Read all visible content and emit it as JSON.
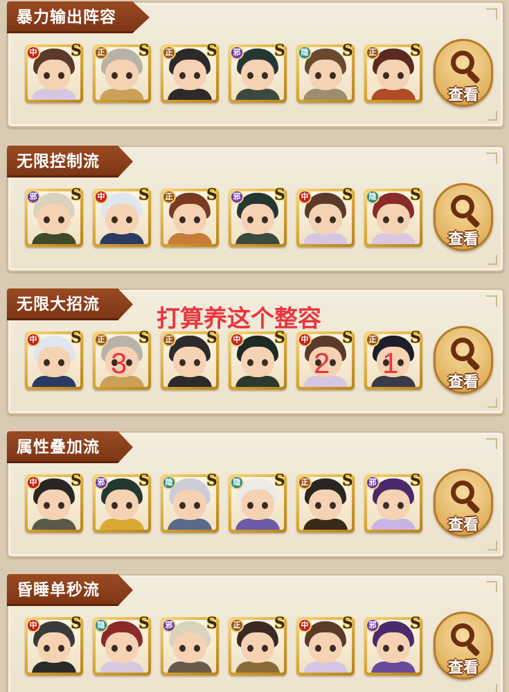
{
  "colors": {
    "zhong": "#c0231b",
    "zheng": "#9a5a1a",
    "xie": "#6a3aa8",
    "yin": "#2b8a86",
    "annotation": "#e8363e"
  },
  "view_label": "查看",
  "lineups": [
    {
      "title": "暴力输出阵容",
      "heroes": [
        {
          "faction": "中",
          "hair": "#5b3a2a",
          "body": "#d6c6e4"
        },
        {
          "faction": "正",
          "hair": "#b9b2a6",
          "body": "#c9a15a"
        },
        {
          "faction": "正",
          "hair": "#2d2b2a",
          "body": "#2c2a2a"
        },
        {
          "faction": "邪",
          "hair": "#243832",
          "body": "#3a4a3e"
        },
        {
          "faction": "隐",
          "hair": "#6a4a2e",
          "body": "#9c8e6e"
        },
        {
          "faction": "正",
          "hair": "#5a2a20",
          "body": "#b04a28"
        }
      ]
    },
    {
      "title": "无限控制流",
      "heroes": [
        {
          "faction": "邪",
          "hair": "#d9d2bd",
          "body": "#3e4a2a"
        },
        {
          "faction": "中",
          "hair": "#dfe6ef",
          "body": "#2b3a63"
        },
        {
          "faction": "正",
          "hair": "#7a3a20",
          "body": "#c97c3a"
        },
        {
          "faction": "邪",
          "hair": "#243832",
          "body": "#3a4a3e"
        },
        {
          "faction": "中",
          "hair": "#5b3a2a",
          "body": "#d6c6e4"
        },
        {
          "faction": "隐",
          "hair": "#8a2a2a",
          "body": "#d9c8e0"
        }
      ]
    },
    {
      "title": "无限大招流",
      "heroes": [
        {
          "faction": "中",
          "hair": "#dfe6ef",
          "body": "#2b3a63"
        },
        {
          "faction": "正",
          "hair": "#b9b2a6",
          "body": "#c9a15a"
        },
        {
          "faction": "正",
          "hair": "#2d2b2a",
          "body": "#2c2a2a"
        },
        {
          "faction": "中",
          "hair": "#1e2a24",
          "body": "#2a3a2c"
        },
        {
          "faction": "中",
          "hair": "#5b3a2a",
          "body": "#d6c6e4"
        },
        {
          "faction": "正",
          "hair": "#1e1e2a",
          "body": "#3a3a4a"
        }
      ]
    },
    {
      "title": "属性叠加流",
      "heroes": [
        {
          "faction": "中",
          "hair": "#2a2622",
          "body": "#5a5a4a"
        },
        {
          "faction": "邪",
          "hair": "#243832",
          "body": "#d9a836"
        },
        {
          "faction": "隐",
          "hair": "#c9ced6",
          "body": "#5a6a8a"
        },
        {
          "faction": "隐",
          "hair": "#ecebe6",
          "body": "#6a5aa8"
        },
        {
          "faction": "正",
          "hair": "#2a2622",
          "body": "#3a2a1a"
        },
        {
          "faction": "邪",
          "hair": "#4a2a6a",
          "body": "#c9b2e4"
        }
      ]
    },
    {
      "title": "昏睡单秒流",
      "heroes": [
        {
          "faction": "中",
          "hair": "#3a3a3a",
          "body": "#2a2a2a"
        },
        {
          "faction": "隐",
          "hair": "#8a2a2a",
          "body": "#d9c8e0"
        },
        {
          "faction": "邪",
          "hair": "#d9d2bd",
          "body": "#6a5a4a"
        },
        {
          "faction": "正",
          "hair": "#3a2a22",
          "body": "#8a6a3a"
        },
        {
          "faction": "中",
          "hair": "#5b3a2a",
          "body": "#d6c6e4"
        },
        {
          "faction": "邪",
          "hair": "#4a2a6a",
          "body": "#6a4a9a"
        }
      ]
    }
  ],
  "annotations": {
    "note": "打算养这个整容",
    "marks": [
      "3",
      "2",
      "1"
    ]
  }
}
